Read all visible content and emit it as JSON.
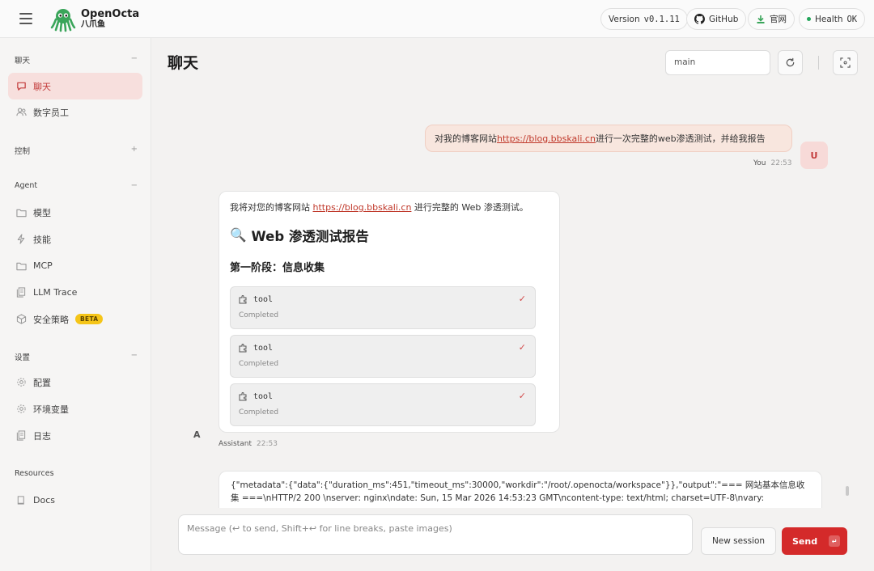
{
  "header": {
    "brand_name": "OpenOcta",
    "brand_sub": "八爪鱼",
    "version_label": "Version",
    "version_value": "v0.1.11",
    "github_label": "GitHub",
    "website_label": "官网",
    "health_label": "Health",
    "health_value": "OK",
    "health_color": "#22a55a"
  },
  "sidebar": {
    "sections": [
      {
        "label": "聊天",
        "toggle": "−"
      },
      {
        "label": "控制",
        "toggle": "+"
      },
      {
        "label": "Agent",
        "toggle": "−"
      },
      {
        "label": "设置",
        "toggle": "−"
      },
      {
        "label": "Resources",
        "toggle": ""
      }
    ],
    "items": [
      {
        "label": "聊天",
        "icon": "chat-bubble-icon",
        "active": true
      },
      {
        "label": "数字员工",
        "icon": "users-icon"
      },
      {
        "label": "模型",
        "icon": "folder-icon"
      },
      {
        "label": "技能",
        "icon": "lightning-icon"
      },
      {
        "label": "MCP",
        "icon": "folder-icon"
      },
      {
        "label": "LLM Trace",
        "icon": "document-stack-icon"
      },
      {
        "label": "安全策略",
        "icon": "cube-icon",
        "badge": "BETA"
      },
      {
        "label": "配置",
        "icon": "gear-icon"
      },
      {
        "label": "环境变量",
        "icon": "gear-icon"
      },
      {
        "label": "日志",
        "icon": "document-stack-icon"
      },
      {
        "label": "Docs",
        "icon": "book-icon"
      }
    ]
  },
  "main": {
    "title": "聊天",
    "session_value": "main",
    "user_message": {
      "prefix": "对我的博客网站 ",
      "link": "https://blog.bbskali.cn",
      "suffix": " 进行一次完整的web渗透测试，并给我报告",
      "sender": "You",
      "time": "22:53",
      "avatar": "U"
    },
    "assistant_message": {
      "intro_prefix": "我将对您的博客网站 ",
      "intro_link": "https://blog.bbskali.cn",
      "intro_suffix": " 进行完整的 Web 渗透测试。",
      "heading_emoji": "🔍",
      "heading": "Web 渗透测试报告",
      "subheading": "第一阶段：信息收集",
      "tools": [
        {
          "name": "tool",
          "status": "Completed",
          "check": "✓"
        },
        {
          "name": "tool",
          "status": "Completed",
          "check": "✓"
        },
        {
          "name": "tool",
          "status": "Completed",
          "check": "✓"
        }
      ],
      "sender": "Assistant",
      "time": "22:53",
      "avatar": "A"
    },
    "output_text": "{\"metadata\":{\"data\":{\"duration_ms\":451,\"timeout_ms\":30000,\"workdir\":\"/root/.openocta/workspace\"}},\"output\":\"=== 网站基本信息收集 ===\\nHTTP/2 200 \\nserver: nginx\\ndate: Sun, 15 Mar 2026 14:53:23 GMT\\ncontent-type: text/html; charset=UTF-8\\nvary:"
  },
  "composer": {
    "placeholder": "Message (↩ to send, Shift+↩ for line breaks, paste images)",
    "new_session_label": "New session",
    "send_label": "Send",
    "send_key": "↵"
  },
  "colors": {
    "accent": "#d42a2a",
    "active_nav_bg": "#f7dfdd",
    "user_bubble_bg": "#f8e6de",
    "beta_badge": "#f5c518"
  }
}
